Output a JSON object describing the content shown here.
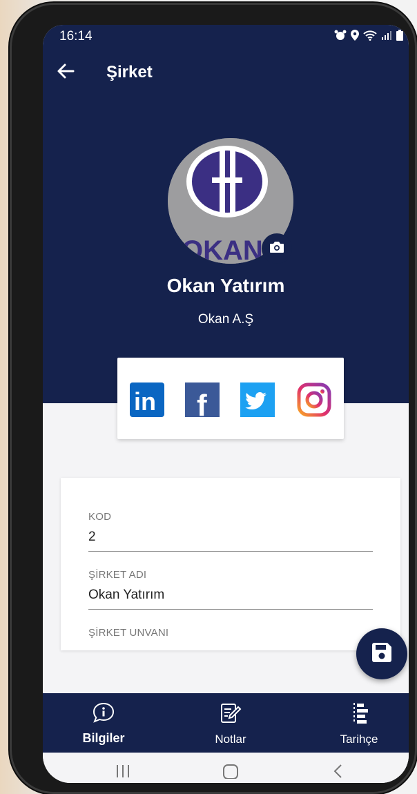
{
  "status_bar": {
    "time": "16:14"
  },
  "header": {
    "title": "Şirket"
  },
  "company": {
    "name": "Okan Yatırım",
    "subtitle": "Okan A.Ş",
    "logo_text": "OKAN"
  },
  "social": [
    {
      "id": "linkedin",
      "icon": "linkedin-icon",
      "text": "in",
      "color": "#0a66c2"
    },
    {
      "id": "facebook",
      "icon": "facebook-icon",
      "text": "f",
      "color": "#3b5998"
    },
    {
      "id": "twitter",
      "icon": "twitter-icon",
      "color": "#1da1f2"
    },
    {
      "id": "instagram",
      "icon": "instagram-icon",
      "color": "#e1306c"
    }
  ],
  "form": {
    "fields": [
      {
        "label": "KOD",
        "value": "2"
      },
      {
        "label": "ŞİRKET ADI",
        "value": "Okan Yatırım"
      },
      {
        "label": "ŞİRKET UNVANI",
        "value": ""
      }
    ]
  },
  "bottom_nav": {
    "items": [
      {
        "label": "Bilgiler",
        "icon": "info-bubble-icon",
        "active": true
      },
      {
        "label": "Notlar",
        "icon": "notes-edit-icon",
        "active": false
      },
      {
        "label": "Tarihçe",
        "icon": "history-list-icon",
        "active": false
      }
    ]
  },
  "colors": {
    "primary": "#15224d",
    "background": "#f4f4f6"
  }
}
